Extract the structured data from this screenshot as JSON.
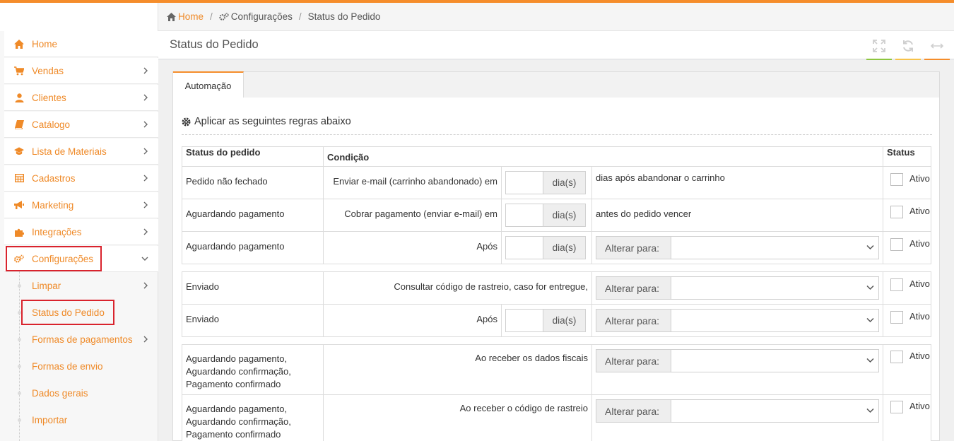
{
  "breadcrumb": {
    "home": "Home",
    "config": "Configurações",
    "current": "Status do Pedido"
  },
  "sidebar": {
    "items": [
      {
        "label": "Home"
      },
      {
        "label": "Vendas"
      },
      {
        "label": "Clientes"
      },
      {
        "label": "Catálogo"
      },
      {
        "label": "Lista de Materiais"
      },
      {
        "label": "Cadastros"
      },
      {
        "label": "Marketing"
      },
      {
        "label": "Integrações"
      },
      {
        "label": "Configurações"
      }
    ],
    "subitems": [
      {
        "label": "Limpar"
      },
      {
        "label": "Status do Pedido"
      },
      {
        "label": "Formas de pagamentos"
      },
      {
        "label": "Formas de envio"
      },
      {
        "label": "Dados gerais"
      },
      {
        "label": "Importar"
      }
    ]
  },
  "page": {
    "title": "Status do Pedido"
  },
  "header_colors": {
    "green": "#8dc63f",
    "yellow": "#f7c34a",
    "orange": "#f58d2b"
  },
  "tab": {
    "label": "Automação"
  },
  "section": {
    "title": "Aplicar as seguintes regras abaixo"
  },
  "table": {
    "headers": {
      "status": "Status do pedido",
      "cond": "Condição",
      "ativo": "Status"
    },
    "days_addon": "dia(s)",
    "alter_label": "Alterar para:",
    "ativo_label": "Ativo",
    "rows": [
      {
        "status": "Pedido não fechado",
        "cond": "Enviar e-mail (carrinho abandonado) em",
        "extra": "dias após abandonar o carrinho"
      },
      {
        "status": "Aguardando pagamento",
        "cond": "Cobrar pagamento (enviar e-mail) em",
        "extra": "antes do pedido vencer"
      },
      {
        "status": "Aguardando pagamento",
        "cond": "Após"
      },
      {
        "status": "Enviado",
        "cond": "Consultar código de rastreio, caso for entregue,"
      },
      {
        "status": "Enviado",
        "cond": "Após"
      },
      {
        "status_lines": [
          "Aguardando pagamento,",
          "Aguardando confirmação,",
          "Pagamento confirmado"
        ],
        "cond": "Ao receber os dados fiscais"
      },
      {
        "status_lines": [
          "Aguardando pagamento,",
          "Aguardando confirmação,",
          "Pagamento confirmado"
        ],
        "cond": "Ao receber o código de rastreio"
      }
    ]
  }
}
